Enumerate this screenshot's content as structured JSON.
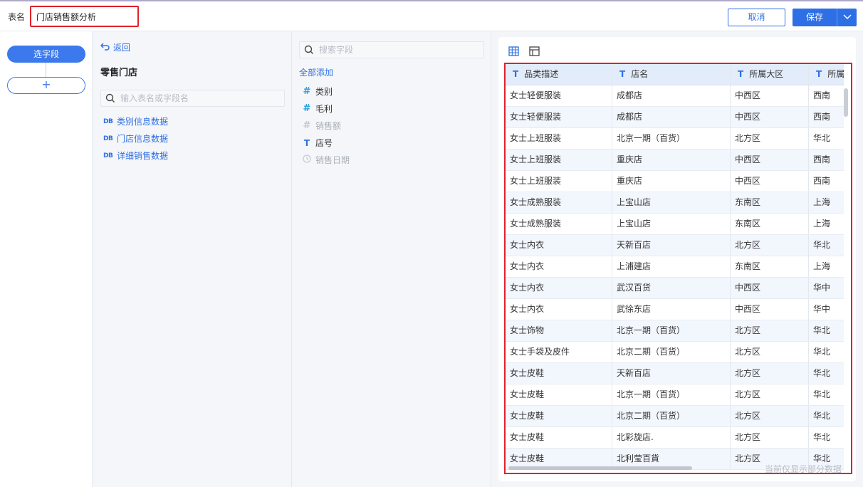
{
  "header": {
    "table_name_label": "表名",
    "table_name_value": "门店销售额分析",
    "cancel_label": "取消",
    "save_label": "保存"
  },
  "steps": {
    "select_fields_label": "选字段",
    "add_step_label": "+"
  },
  "tables_panel": {
    "back_label": "返回",
    "package_title": "零售门店",
    "search_placeholder": "输入表名或字段名",
    "tables": [
      {
        "icon": "DB",
        "label": "类别信息数据"
      },
      {
        "icon": "DB",
        "label": "门店信息数据"
      },
      {
        "icon": "DB",
        "label": "详细销售数据"
      }
    ]
  },
  "fields_panel": {
    "search_placeholder": "搜索字段",
    "add_all_label": "全部添加",
    "fields": [
      {
        "type": "number",
        "label": "类别",
        "enabled": true
      },
      {
        "type": "number",
        "label": "毛利",
        "enabled": true
      },
      {
        "type": "number",
        "label": "销售额",
        "enabled": false
      },
      {
        "type": "text",
        "label": "店号",
        "enabled": true
      },
      {
        "type": "date",
        "label": "销售日期",
        "enabled": false
      }
    ]
  },
  "preview": {
    "columns": [
      "品类描述",
      "店名",
      "所属大区",
      "所属"
    ],
    "rows": [
      [
        "女士轻便服装",
        "成都店",
        "中西区",
        "西南"
      ],
      [
        "女士轻便服装",
        "成都店",
        "中西区",
        "西南"
      ],
      [
        "女士上班服装",
        "北京一期（百货）",
        "北方区",
        "华北"
      ],
      [
        "女士上班服装",
        "重庆店",
        "中西区",
        "西南"
      ],
      [
        "女士上班服装",
        "重庆店",
        "中西区",
        "西南"
      ],
      [
        "女士成熟服装",
        "上宝山店",
        "东南区",
        "上海"
      ],
      [
        "女士成熟服装",
        "上宝山店",
        "东南区",
        "上海"
      ],
      [
        "女士内衣",
        "天新百店",
        "北方区",
        "华北"
      ],
      [
        "女士内衣",
        "上浦建店",
        "东南区",
        "上海"
      ],
      [
        "女士内衣",
        "武汉百货",
        "中西区",
        "华中"
      ],
      [
        "女士内衣",
        "武徐东店",
        "中西区",
        "华中"
      ],
      [
        "女士饰物",
        "北京一期（百货）",
        "北方区",
        "华北"
      ],
      [
        "女士手袋及皮件",
        "北京二期（百货）",
        "北方区",
        "华北"
      ],
      [
        "女士皮鞋",
        "天新百店",
        "北方区",
        "华北"
      ],
      [
        "女士皮鞋",
        "北京一期（百货）",
        "北方区",
        "华北"
      ],
      [
        "女士皮鞋",
        "北京二期（百货）",
        "北方区",
        "华北"
      ],
      [
        "女士皮鞋",
        "北彩旋店.",
        "北方区",
        "华北"
      ],
      [
        "女士皮鞋",
        "北利莹百貨",
        "北方区",
        "华北"
      ]
    ],
    "footer_note": "当前仅显示部分数据"
  }
}
